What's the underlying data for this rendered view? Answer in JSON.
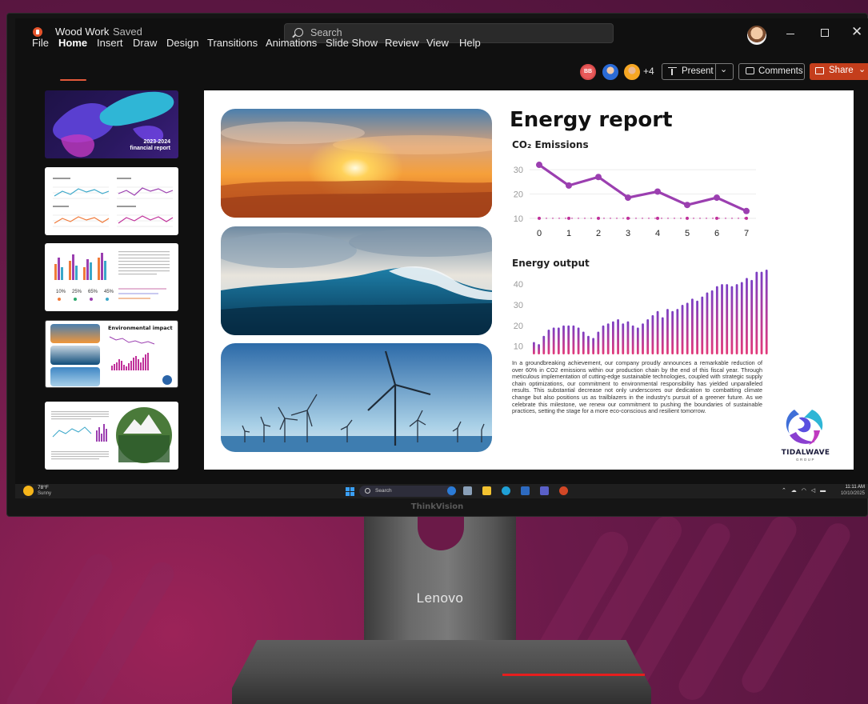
{
  "colors": {
    "accent": "#c43e1c",
    "chart_purple": "#9b3fb0",
    "bar_gradient_top": "#7b3fc4",
    "bar_gradient_bottom": "#e2397a",
    "taskbar": "#1f1f1f"
  },
  "window": {
    "app_icon": "powerpoint-icon",
    "doc_title": "Wood Work",
    "doc_status": "Saved",
    "search_placeholder": "Search"
  },
  "menu": {
    "items": [
      "File",
      "Home",
      "Insert",
      "Draw",
      "Design",
      "Transitions",
      "Animations",
      "Slide Show",
      "Review",
      "View",
      "Help"
    ],
    "active": "Home"
  },
  "collab": {
    "initials": "BB",
    "more_count": "+4",
    "present_label": "Present",
    "comments_label": "Comments",
    "share_label": "Share"
  },
  "thumbnails": {
    "slide1_line1": "2023-2024",
    "slide1_line2": "financial report",
    "slide4_title": "Environmental impact",
    "slide3_stats": [
      "10%",
      "25%",
      "65%",
      "45%"
    ]
  },
  "slide": {
    "title": "Energy report",
    "chart1_title": "CO₂ Emissions",
    "chart2_title": "Energy output",
    "paragraph": "In a groundbreaking achievement, our company proudly announces a remarkable reduction of over 60% in CO2 emissions within our production chain by the end of this fiscal year. Through meticulous implementation of cutting-edge sustainable technologies, coupled with strategic supply chain optimizations, our commitment to environmental responsibility has yielded unparalleled results. This substantial decrease not only underscores our dedication to combatting climate change but also positions us as trailblazers in the industry's pursuit of a greener future. As we celebrate this milestone, we renew our commitment to pushing the boundaries of sustainable practices, setting the stage for a more eco-conscious and resilient tomorrow.",
    "logo_name": "TIDALWAVE",
    "logo_sub": "GROUP"
  },
  "chart_data": [
    {
      "type": "line",
      "title": "CO₂ Emissions",
      "x": [
        0,
        1,
        2,
        3,
        4,
        5,
        6,
        7
      ],
      "series": [
        {
          "values": [
            32,
            23.5,
            27,
            18.5,
            21,
            15.5,
            18.5,
            13
          ]
        },
        {
          "values": [
            10,
            10,
            10,
            10,
            10,
            10,
            10,
            10
          ]
        }
      ],
      "yticks": [
        10,
        20,
        30
      ],
      "ylim": [
        8,
        33
      ],
      "grid": true
    },
    {
      "type": "bar",
      "title": "Energy output",
      "values": [
        12,
        11,
        15,
        18,
        19,
        19,
        20,
        20,
        20,
        19,
        17,
        15,
        14,
        17,
        20,
        21,
        22,
        23,
        21,
        22,
        20,
        19,
        21,
        23,
        25,
        27,
        24,
        28,
        27,
        28,
        30,
        31,
        33,
        32,
        34,
        36,
        37,
        39,
        40,
        40,
        39,
        40,
        41,
        43,
        42,
        46,
        46,
        47
      ],
      "yticks": [
        10,
        20,
        30,
        40
      ],
      "ylim": [
        6,
        47
      ]
    }
  ],
  "taskbar": {
    "weather_temp": "78°F",
    "weather_desc": "Sunny",
    "search_label": "Search",
    "time": "11:11 AM",
    "date": "10/10/2025"
  },
  "hardware": {
    "monitor_brand": "ThinkVision",
    "stand_logo": "Lenovo"
  }
}
